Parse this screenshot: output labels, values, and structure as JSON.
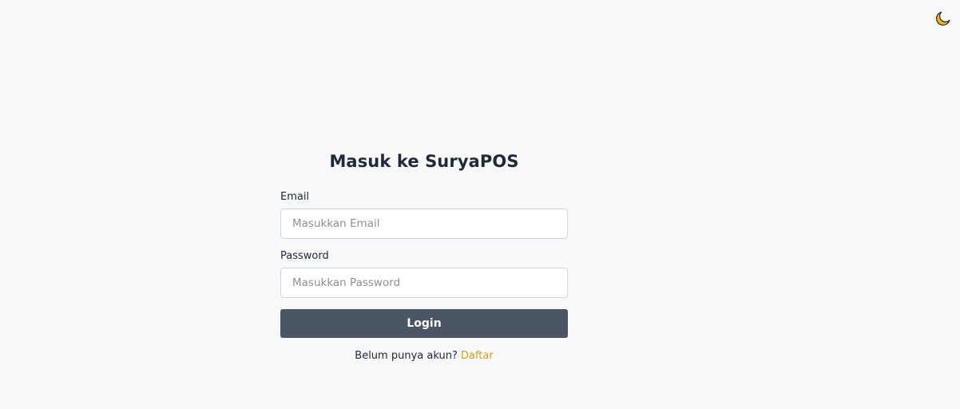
{
  "theme_toggle": {
    "icon": "moon-icon",
    "icon_color": "#f5b400"
  },
  "login": {
    "title": "Masuk ke SuryaPOS",
    "email_label": "Email",
    "email_placeholder": "Masukkan Email",
    "email_value": "",
    "password_label": "Password",
    "password_placeholder": "Masukkan Password",
    "password_value": "",
    "submit_label": "Login",
    "register_prompt": "Belum punya akun?",
    "register_link": "Daftar"
  },
  "colors": {
    "background": "#f8f9fb",
    "button": "#4b5563",
    "link": "#d4a017"
  }
}
